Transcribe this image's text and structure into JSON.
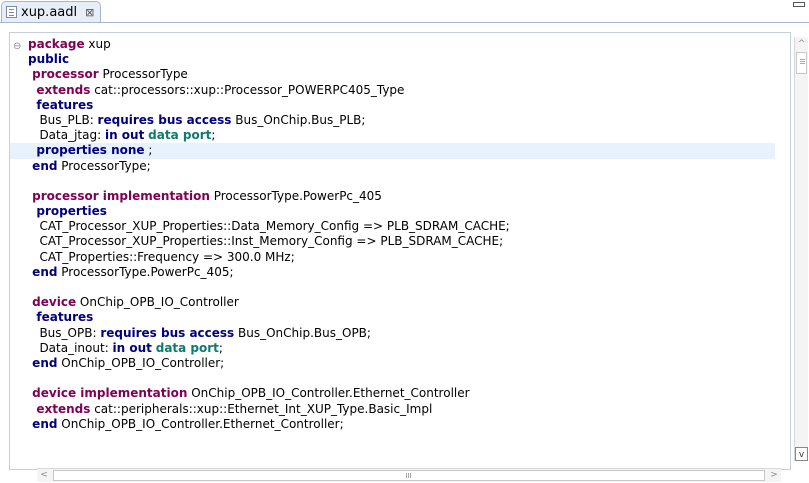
{
  "tab": {
    "title": "xup.aadl",
    "close": "⊠"
  },
  "code_lines": [
    [
      {
        "t": "package",
        "c": "kw"
      },
      {
        "t": " xup",
        "c": ""
      }
    ],
    [
      {
        "t": "public",
        "c": "kw2"
      }
    ],
    [
      {
        "t": " processor",
        "c": "kw"
      },
      {
        "t": " ProcessorType",
        "c": ""
      }
    ],
    [
      {
        "t": "  extends",
        "c": "kw"
      },
      {
        "t": " cat::processors::xup::Processor_POWERPC405_Type",
        "c": ""
      }
    ],
    [
      {
        "t": "  features",
        "c": "kw2"
      }
    ],
    [
      {
        "t": "   Bus_PLB: ",
        "c": ""
      },
      {
        "t": "requires bus access",
        "c": "kw2"
      },
      {
        "t": " Bus_OnChip.Bus_PLB;",
        "c": ""
      }
    ],
    [
      {
        "t": "   Data_jtag: ",
        "c": ""
      },
      {
        "t": "in out",
        "c": "kw2"
      },
      {
        "t": " ",
        "c": ""
      },
      {
        "t": "data port",
        "c": "kw3"
      },
      {
        "t": ";",
        "c": ""
      }
    ],
    [
      {
        "t": "  properties none",
        "c": "kw2"
      },
      {
        "t": " ;",
        "c": ""
      }
    ],
    [
      {
        "t": " end",
        "c": "kw2"
      },
      {
        "t": " ProcessorType;",
        "c": ""
      }
    ],
    [
      {
        "t": "",
        "c": ""
      }
    ],
    [
      {
        "t": " processor implementation",
        "c": "kw"
      },
      {
        "t": " ProcessorType.PowerPc_405",
        "c": ""
      }
    ],
    [
      {
        "t": "  properties",
        "c": "kw2"
      }
    ],
    [
      {
        "t": "   CAT_Processor_XUP_Properties::Data_Memory_Config => PLB_SDRAM_CACHE;",
        "c": ""
      }
    ],
    [
      {
        "t": "   CAT_Processor_XUP_Properties::Inst_Memory_Config => PLB_SDRAM_CACHE;",
        "c": ""
      }
    ],
    [
      {
        "t": "   CAT_Properties::Frequency => 300.0 MHz;",
        "c": ""
      }
    ],
    [
      {
        "t": " end",
        "c": "kw2"
      },
      {
        "t": " ProcessorType.PowerPc_405;",
        "c": ""
      }
    ],
    [
      {
        "t": "",
        "c": ""
      }
    ],
    [
      {
        "t": " device",
        "c": "kw"
      },
      {
        "t": " OnChip_OPB_IO_Controller",
        "c": ""
      }
    ],
    [
      {
        "t": "  features",
        "c": "kw2"
      }
    ],
    [
      {
        "t": "   Bus_OPB: ",
        "c": ""
      },
      {
        "t": "requires bus access",
        "c": "kw2"
      },
      {
        "t": " Bus_OnChip.Bus_OPB;",
        "c": ""
      }
    ],
    [
      {
        "t": "   Data_inout: ",
        "c": ""
      },
      {
        "t": "in out",
        "c": "kw2"
      },
      {
        "t": " ",
        "c": ""
      },
      {
        "t": "data port",
        "c": "kw3"
      },
      {
        "t": ";",
        "c": ""
      }
    ],
    [
      {
        "t": " end",
        "c": "kw2"
      },
      {
        "t": " OnChip_OPB_IO_Controller;",
        "c": ""
      }
    ],
    [
      {
        "t": "",
        "c": ""
      }
    ],
    [
      {
        "t": " device implementation",
        "c": "kw"
      },
      {
        "t": " OnChip_OPB_IO_Controller.Ethernet_Controller",
        "c": ""
      }
    ],
    [
      {
        "t": "  extends",
        "c": "kw"
      },
      {
        "t": " cat::peripherals::xup::Ethernet_Int_XUP_Type.Basic_Impl",
        "c": ""
      }
    ],
    [
      {
        "t": " end",
        "c": "kw2"
      },
      {
        "t": " OnChip_OPB_IO_Controller.Ethernet_Controller;",
        "c": ""
      }
    ]
  ],
  "highlighted_line": 7,
  "fold_marker": "⊖",
  "scrollbars": {
    "up": "^",
    "down": "v",
    "left": "<",
    "right": ">"
  },
  "colors": {
    "keyword": "#7f0055",
    "keyword_blue": "#000080",
    "keyword_teal": "#0f7a6e",
    "line_highlight": "#e8f2fe"
  }
}
